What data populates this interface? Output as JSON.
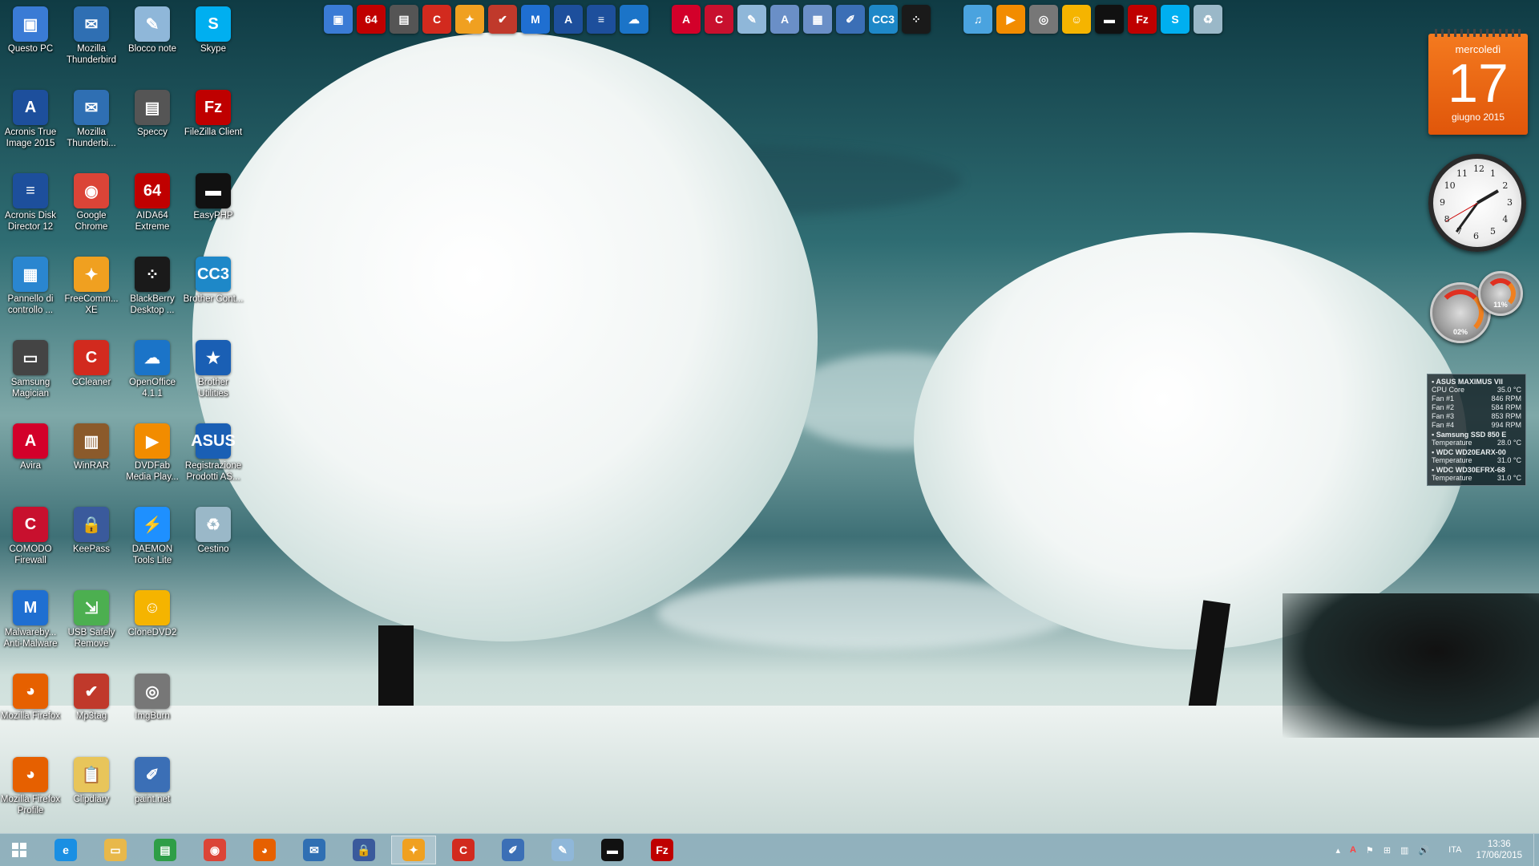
{
  "desktop_icons": [
    {
      "label": "Questo PC",
      "icon": "computer-icon",
      "color": "#3a7bd5",
      "glyph": "▣"
    },
    {
      "label": "Mozilla Thunderbird",
      "icon": "thunderbird-icon",
      "color": "#2f6fb3",
      "glyph": "✉"
    },
    {
      "label": "Blocco note",
      "icon": "notepad-icon",
      "color": "#8fb7d9",
      "glyph": "✎"
    },
    {
      "label": "Skype",
      "icon": "skype-icon",
      "color": "#00aff0",
      "glyph": "S"
    },
    {
      "label": "Acronis True Image 2015",
      "icon": "acronis-icon",
      "color": "#1d4f9c",
      "glyph": "A"
    },
    {
      "label": "Mozilla Thunderbi...",
      "icon": "thunderbird-icon",
      "color": "#2f6fb3",
      "glyph": "✉"
    },
    {
      "label": "Speccy",
      "icon": "speccy-icon",
      "color": "#555555",
      "glyph": "▤"
    },
    {
      "label": "FileZilla Client",
      "icon": "filezilla-icon",
      "color": "#bf0000",
      "glyph": "Fz"
    },
    {
      "label": "Acronis Disk Director 12",
      "icon": "acronis-disk-icon",
      "color": "#1d4f9c",
      "glyph": "≡"
    },
    {
      "label": "Google Chrome",
      "icon": "chrome-icon",
      "color": "#db4437",
      "glyph": "◉"
    },
    {
      "label": "AIDA64 Extreme",
      "icon": "aida64-icon",
      "color": "#c00000",
      "glyph": "64"
    },
    {
      "label": "EasyPHP",
      "icon": "easyphp-icon",
      "color": "#111111",
      "glyph": "▬"
    },
    {
      "label": "Pannello di controllo ...",
      "icon": "control-panel-icon",
      "color": "#2a86d0",
      "glyph": "▦"
    },
    {
      "label": "FreeComm... XE",
      "icon": "freecommander-icon",
      "color": "#f0a020",
      "glyph": "✦"
    },
    {
      "label": "BlackBerry Desktop ...",
      "icon": "blackberry-icon",
      "color": "#1a1a1a",
      "glyph": "⁘"
    },
    {
      "label": "Brother Cont...",
      "icon": "brother-icon",
      "color": "#1e88c8",
      "glyph": "CC3"
    },
    {
      "label": "Samsung Magician",
      "icon": "samsung-icon",
      "color": "#444444",
      "glyph": "▭"
    },
    {
      "label": "CCleaner",
      "icon": "ccleaner-icon",
      "color": "#d22a1e",
      "glyph": "C"
    },
    {
      "label": "OpenOffice 4.1.1",
      "icon": "openoffice-icon",
      "color": "#1b74c8",
      "glyph": "☁"
    },
    {
      "label": "Brother Utilities",
      "icon": "brother-utilities-icon",
      "color": "#1a5fb4",
      "glyph": "★"
    },
    {
      "label": "Avira",
      "icon": "avira-icon",
      "color": "#d3002a",
      "glyph": "A"
    },
    {
      "label": "WinRAR",
      "icon": "winrar-icon",
      "color": "#8b5a2b",
      "glyph": "▥"
    },
    {
      "label": "DVDFab Media Play...",
      "icon": "dvdfab-icon",
      "color": "#f28c00",
      "glyph": "▶"
    },
    {
      "label": "Registrazione Prodotti AS...",
      "icon": "asus-icon",
      "color": "#1a5fb4",
      "glyph": "ASUS"
    },
    {
      "label": "COMODO Firewall",
      "icon": "comodo-icon",
      "color": "#c8102e",
      "glyph": "C"
    },
    {
      "label": "KeePass",
      "icon": "keepass-icon",
      "color": "#3a5a9c",
      "glyph": "🔒"
    },
    {
      "label": "DAEMON Tools Lite",
      "icon": "daemon-tools-icon",
      "color": "#1e90ff",
      "glyph": "⚡"
    },
    {
      "label": "Cestino",
      "icon": "recycle-bin-icon",
      "color": "#9ab8c8",
      "glyph": "♻"
    },
    {
      "label": "Malwareby... Anti-Malware",
      "icon": "malwarebytes-icon",
      "color": "#1f6fd1",
      "glyph": "M"
    },
    {
      "label": "USB Safely Remove",
      "icon": "usb-icon",
      "color": "#4caf50",
      "glyph": "⇲"
    },
    {
      "label": "CloneDVD2",
      "icon": "clonedvd-icon",
      "color": "#f5b400",
      "glyph": "☺"
    },
    {
      "label": "Mozilla Firefox",
      "icon": "firefox-icon",
      "color": "#e66000",
      "glyph": "◕"
    },
    {
      "label": "Mp3tag",
      "icon": "mp3tag-icon",
      "color": "#c0392b",
      "glyph": "✔"
    },
    {
      "label": "ImgBurn",
      "icon": "imgburn-icon",
      "color": "#777777",
      "glyph": "◎"
    },
    {
      "label": "Mozilla Firefox Profile",
      "icon": "firefox-profile-icon",
      "color": "#e66000",
      "glyph": "◕"
    },
    {
      "label": "Clipdiary",
      "icon": "clipdiary-icon",
      "color": "#e8c55a",
      "glyph": "📋"
    },
    {
      "label": "paint.net",
      "icon": "paintnet-icon",
      "color": "#3b6fb6",
      "glyph": "✐"
    }
  ],
  "dock_left": [
    {
      "icon": "computer-icon",
      "color": "#3a7bd5",
      "glyph": "▣"
    },
    {
      "icon": "aida64-icon",
      "color": "#c00000",
      "glyph": "64"
    },
    {
      "icon": "speccy-icon",
      "color": "#555555",
      "glyph": "▤"
    },
    {
      "icon": "ccleaner-icon",
      "color": "#d22a1e",
      "glyph": "C"
    },
    {
      "icon": "freecommander-icon",
      "color": "#f0a020",
      "glyph": "✦"
    },
    {
      "icon": "mp3tag-icon",
      "color": "#c0392b",
      "glyph": "✔"
    },
    {
      "icon": "malwarebytes-icon",
      "color": "#1f6fd1",
      "glyph": "M"
    },
    {
      "icon": "acronis-icon",
      "color": "#1d4f9c",
      "glyph": "A"
    },
    {
      "icon": "acronis-disk-icon",
      "color": "#1d4f9c",
      "glyph": "≡"
    },
    {
      "icon": "openoffice-icon",
      "color": "#1b74c8",
      "glyph": "☁"
    }
  ],
  "dock_mid": [
    {
      "icon": "avira-icon",
      "color": "#d3002a",
      "glyph": "A"
    },
    {
      "icon": "comodo-icon",
      "color": "#c8102e",
      "glyph": "C"
    },
    {
      "icon": "notepad-icon",
      "color": "#8fb7d9",
      "glyph": "✎"
    },
    {
      "icon": "document-icon",
      "color": "#6a8fc7",
      "glyph": "A"
    },
    {
      "icon": "calculator-icon",
      "color": "#6a8fc7",
      "glyph": "▦"
    },
    {
      "icon": "paintnet-icon",
      "color": "#3b6fb6",
      "glyph": "✐"
    },
    {
      "icon": "brother-icon",
      "color": "#1e88c8",
      "glyph": "CC3"
    },
    {
      "icon": "blackberry-icon",
      "color": "#1a1a1a",
      "glyph": "⁘"
    }
  ],
  "dock_right": [
    {
      "icon": "itunes-icon",
      "color": "#4aa3df",
      "glyph": "♫"
    },
    {
      "icon": "dvdfab-icon",
      "color": "#f28c00",
      "glyph": "▶"
    },
    {
      "icon": "imgburn-icon",
      "color": "#777777",
      "glyph": "◎"
    },
    {
      "icon": "clonedvd-icon",
      "color": "#f5b400",
      "glyph": "☺"
    },
    {
      "icon": "easyphp-icon",
      "color": "#111111",
      "glyph": "▬"
    },
    {
      "icon": "filezilla-icon",
      "color": "#bf0000",
      "glyph": "Fz"
    },
    {
      "icon": "skype-icon",
      "color": "#00aff0",
      "glyph": "S"
    },
    {
      "icon": "recycle-bin-icon",
      "color": "#9ab8c8",
      "glyph": "♻"
    }
  ],
  "calendar": {
    "weekday": "mercoledì",
    "day": "17",
    "month": "giugno 2015"
  },
  "clock_gadget": {
    "numbers": [
      "12",
      "1",
      "2",
      "3",
      "4",
      "5",
      "6",
      "7",
      "8",
      "9",
      "10",
      "11"
    ]
  },
  "meters": [
    {
      "value": "02%",
      "icon": "cpu-meter-icon"
    },
    {
      "value": "11%",
      "icon": "memory-meter-icon"
    }
  ],
  "sensor": {
    "title": "ASUS MAXIMUS VII",
    "rows": [
      {
        "k": "CPU Core",
        "v": "35.0 °C"
      },
      {
        "k": "Fan #1",
        "v": "846 RPM"
      },
      {
        "k": "Fan #2",
        "v": "584 RPM"
      },
      {
        "k": "Fan #3",
        "v": "853 RPM"
      },
      {
        "k": "Fan #4",
        "v": "994 RPM"
      }
    ],
    "drives": [
      {
        "name": "Samsung SSD 850 E",
        "label": "Temperature",
        "v": "28.0 °C"
      },
      {
        "name": "WDC WD20EARX-00",
        "label": "Temperature",
        "v": "31.0 °C"
      },
      {
        "name": "WDC WD30EFRX-68",
        "label": "Temperature",
        "v": "31.0 °C"
      }
    ]
  },
  "taskbar": {
    "pinned": [
      {
        "icon": "internet-explorer-icon",
        "color": "#1a8fe3",
        "glyph": "e"
      },
      {
        "icon": "file-explorer-icon",
        "color": "#e8b84a",
        "glyph": "▭"
      },
      {
        "icon": "store-icon",
        "color": "#2e9e47",
        "glyph": "▤"
      },
      {
        "icon": "chrome-icon",
        "color": "#db4437",
        "glyph": "◉"
      },
      {
        "icon": "firefox-icon",
        "color": "#e66000",
        "glyph": "◕"
      },
      {
        "icon": "thunderbird-icon",
        "color": "#2f6fb3",
        "glyph": "✉"
      },
      {
        "icon": "keepass-icon",
        "color": "#3a5a9c",
        "glyph": "🔒"
      },
      {
        "icon": "freecommander-icon",
        "color": "#f0a020",
        "glyph": "✦"
      },
      {
        "icon": "ccleaner-icon",
        "color": "#d22a1e",
        "glyph": "C"
      },
      {
        "icon": "paintnet-icon",
        "color": "#3b6fb6",
        "glyph": "✐"
      },
      {
        "icon": "notepad-icon",
        "color": "#8fb7d9",
        "glyph": "✎"
      },
      {
        "icon": "easyphp-icon",
        "color": "#111111",
        "glyph": "▬"
      },
      {
        "icon": "filezilla-icon",
        "color": "#bf0000",
        "glyph": "Fz"
      }
    ],
    "language": "ITA",
    "time": "13:36",
    "date": "17/06/2015"
  }
}
